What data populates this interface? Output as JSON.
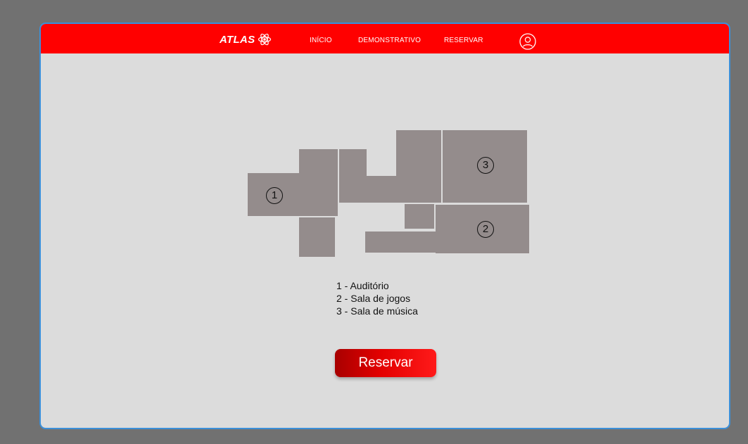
{
  "brand": {
    "name": "ATLAS",
    "icon": "atom-icon"
  },
  "nav": {
    "items": [
      {
        "label": "INÍCIO"
      },
      {
        "label": "DEMONSTRATIVO"
      },
      {
        "label": "RESERVAR"
      }
    ],
    "profile_icon": "user-icon"
  },
  "floorplan": {
    "labels": [
      "1",
      "2",
      "3"
    ]
  },
  "legend": [
    "1 - Auditório",
    "2 - Sala de jogos",
    "3 - Sala de música"
  ],
  "action": {
    "reserve_label": "Reservar"
  },
  "colors": {
    "navbar": "#ff0000",
    "page_background": "#dcdcdc",
    "room_fill": "#948c8c",
    "frame_border": "#3b8fd9"
  }
}
